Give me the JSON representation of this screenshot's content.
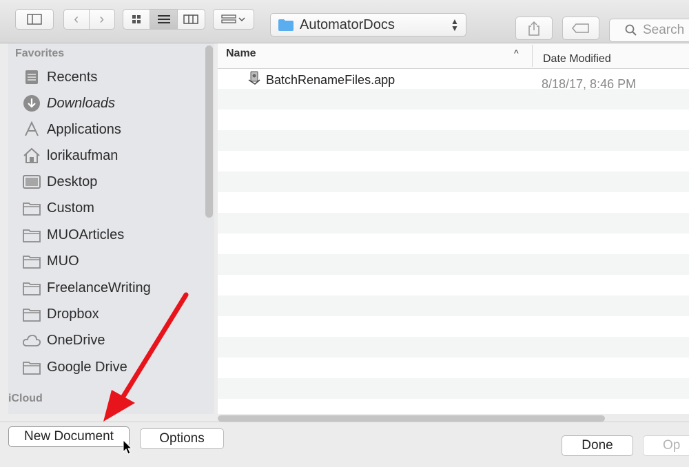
{
  "toolbar": {
    "location_label": "AutomatorDocs",
    "search_placeholder": "Search"
  },
  "sidebar": {
    "favorites_header": "Favorites",
    "icloud_header": "iCloud",
    "items": [
      {
        "label": "Recents",
        "icon": "recents-icon"
      },
      {
        "label": "Downloads",
        "icon": "downloads-icon"
      },
      {
        "label": "Applications",
        "icon": "applications-icon"
      },
      {
        "label": "lorikaufman",
        "icon": "home-icon"
      },
      {
        "label": "Desktop",
        "icon": "desktop-icon"
      },
      {
        "label": "Custom",
        "icon": "folder-icon"
      },
      {
        "label": "MUOArticles",
        "icon": "folder-icon"
      },
      {
        "label": "MUO",
        "icon": "folder-icon"
      },
      {
        "label": "FreelanceWriting",
        "icon": "folder-icon"
      },
      {
        "label": "Dropbox",
        "icon": "folder-icon"
      },
      {
        "label": "OneDrive",
        "icon": "cloud-icon"
      },
      {
        "label": "Google Drive",
        "icon": "folder-icon"
      }
    ]
  },
  "list": {
    "col_name": "Name",
    "col_date": "Date Modified",
    "sort_indicator": "^",
    "files": [
      {
        "name": "BatchRenameFiles.app",
        "date": "8/18/17, 8:46 PM",
        "icon": "automator-app-icon"
      }
    ]
  },
  "bottom": {
    "new_document_label": "New Document",
    "options_label": "Options",
    "done_label": "Done",
    "open_label": "Op"
  },
  "colors": {
    "annotation_arrow": "#e8141b",
    "folder_icon": "#5aaef0"
  }
}
